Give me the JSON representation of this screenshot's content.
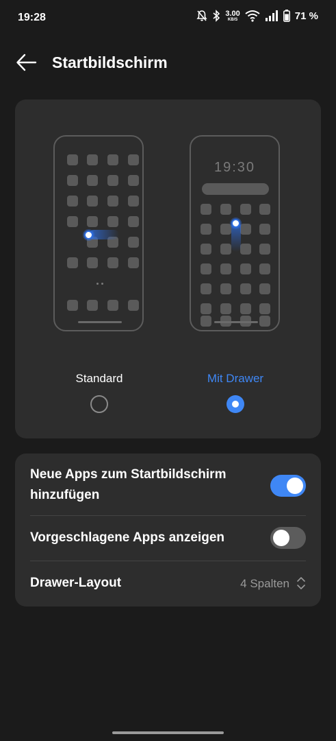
{
  "status_bar": {
    "time": "19:28",
    "speed_value": "3.00",
    "speed_unit": "KB/S",
    "battery_percent": "71 %",
    "icons": [
      "bell-muted-icon",
      "bluetooth-icon",
      "wifi-icon",
      "signal-icon",
      "battery-icon"
    ]
  },
  "header": {
    "title": "Startbildschirm",
    "back_icon": "arrow-left-icon"
  },
  "layout_options": {
    "standard_label": "Standard",
    "drawer_label": "Mit Drawer",
    "drawer_clock": "19:30",
    "selected": "Mit Drawer"
  },
  "settings": {
    "new_apps": {
      "label_line1": "Neue Apps zum Startbildschirm",
      "label_line2": "hinzufügen",
      "enabled": true
    },
    "suggested_apps": {
      "label": "Vorgeschlagene Apps anzeigen",
      "enabled": false
    },
    "drawer_layout": {
      "label": "Drawer-Layout",
      "value": "4 Spalten"
    }
  },
  "colors": {
    "accent": "#3f87f5",
    "background": "#1b1b1b",
    "card": "#2d2d2d"
  }
}
